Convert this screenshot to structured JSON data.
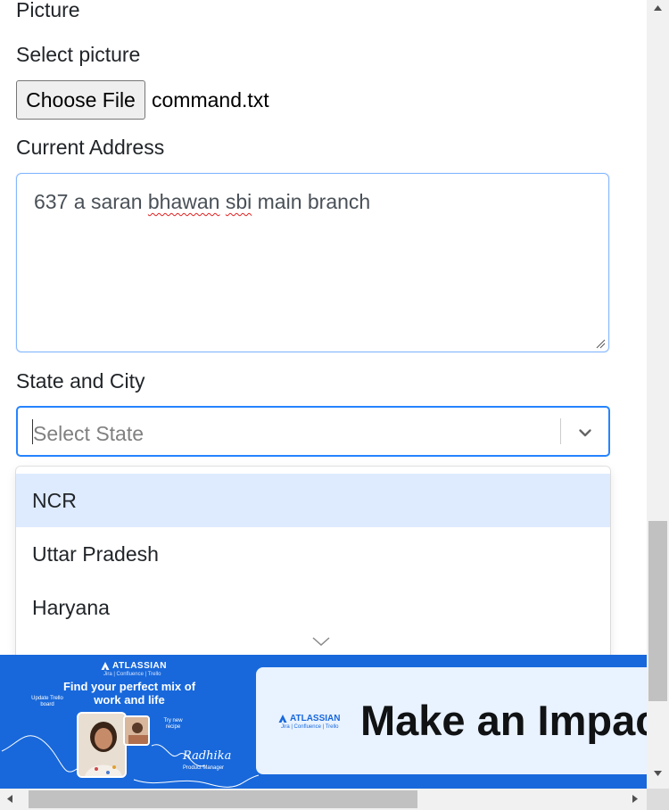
{
  "form": {
    "picture_label": "Picture",
    "select_picture_label": "Select picture",
    "choose_file_label": "Choose File",
    "file_name": "command.txt",
    "address_label": "Current Address",
    "address_value_parts": [
      "637 a saran ",
      "bhawan",
      " ",
      "sbi",
      " main branch"
    ],
    "state_city_label": "State and City",
    "state_placeholder": "Select State",
    "state_options": [
      "NCR",
      "Uttar Pradesh",
      "Haryana"
    ]
  },
  "ad": {
    "brand": "ATLASSIAN",
    "products": "Jira | Confluence | Trello",
    "headline": "Find your perfect mix of work and life",
    "note_1": "Update Trello board",
    "note_2": "Try new recipe",
    "signature": "Radhika",
    "role": "Product Manager",
    "big_text": "Make an Impact"
  },
  "colors": {
    "focus_border": "#2684ff",
    "option_highlight": "#deebff",
    "ad_blue": "#1868db",
    "ad_card": "#e9f2ff"
  }
}
